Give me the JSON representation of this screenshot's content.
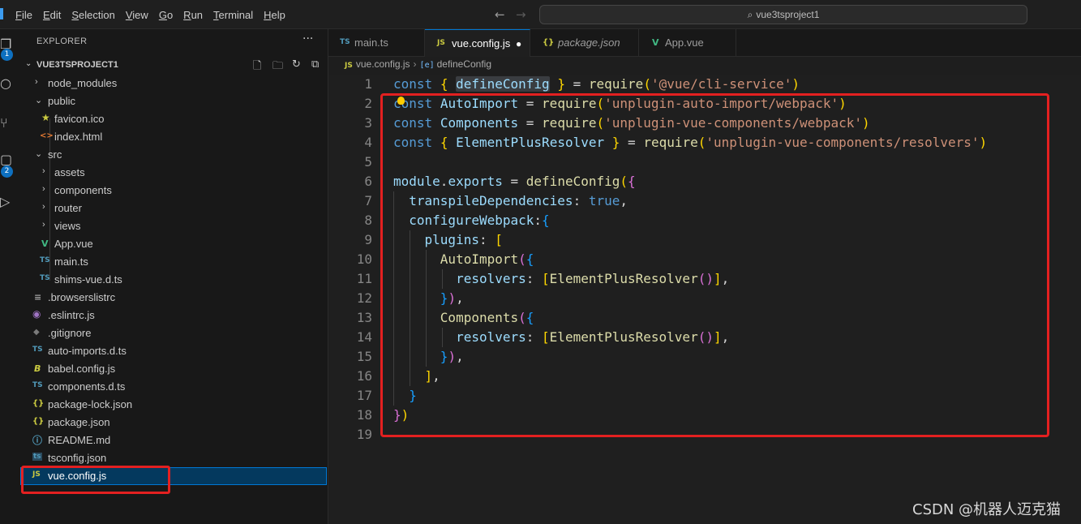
{
  "menubar": [
    "File",
    "Edit",
    "Selection",
    "View",
    "Go",
    "Run",
    "Terminal",
    "Help"
  ],
  "titlebar": {
    "search_text": "vue3tsproject1",
    "back_icon": "arrow-left",
    "forward_icon": "arrow-right"
  },
  "activitybar": {
    "explorer_badge": "1",
    "extensions_badge": "2"
  },
  "sidebar": {
    "title": "EXPLORER",
    "more_label": "···",
    "project_name": "VUE3TSPROJECT1",
    "tree": [
      {
        "label": "node_modules",
        "kind": "folder",
        "expanded": false
      },
      {
        "label": "public",
        "kind": "folder",
        "expanded": true
      },
      {
        "label": "favicon.ico",
        "kind": "file",
        "icon": "★"
      },
      {
        "label": "index.html",
        "kind": "file",
        "icon": "<>"
      },
      {
        "label": "src",
        "kind": "folder",
        "expanded": true
      },
      {
        "label": "assets",
        "kind": "folder",
        "expanded": false
      },
      {
        "label": "components",
        "kind": "folder",
        "expanded": false
      },
      {
        "label": "router",
        "kind": "folder",
        "expanded": false
      },
      {
        "label": "views",
        "kind": "folder",
        "expanded": false
      },
      {
        "label": "App.vue",
        "kind": "file",
        "icon": "V"
      },
      {
        "label": "main.ts",
        "kind": "file",
        "icon": "TS"
      },
      {
        "label": "shims-vue.d.ts",
        "kind": "file",
        "icon": "TS"
      },
      {
        "label": ".browserslistrc",
        "kind": "file",
        "icon": "≡"
      },
      {
        "label": ".eslintrc.js",
        "kind": "file",
        "icon": "◉"
      },
      {
        "label": ".gitignore",
        "kind": "file",
        "icon": "◆"
      },
      {
        "label": "auto-imports.d.ts",
        "kind": "file",
        "icon": "TS"
      },
      {
        "label": "babel.config.js",
        "kind": "file",
        "icon": "B"
      },
      {
        "label": "components.d.ts",
        "kind": "file",
        "icon": "TS"
      },
      {
        "label": "package-lock.json",
        "kind": "file",
        "icon": "{}"
      },
      {
        "label": "package.json",
        "kind": "file",
        "icon": "{}"
      },
      {
        "label": "README.md",
        "kind": "file",
        "icon": "ⓘ"
      },
      {
        "label": "tsconfig.json",
        "kind": "file",
        "icon": "ts"
      },
      {
        "label": "vue.config.js",
        "kind": "file",
        "icon": "JS",
        "selected": true
      }
    ]
  },
  "tabs": [
    {
      "label": "main.ts",
      "icon": "TS",
      "active": false
    },
    {
      "label": "vue.config.js",
      "icon": "JS",
      "active": true,
      "dirty": true
    },
    {
      "label": "package.json",
      "icon": "{}",
      "active": false,
      "italic": true
    },
    {
      "label": "App.vue",
      "icon": "V",
      "active": false
    }
  ],
  "breadcrumb": {
    "file": "vue.config.js",
    "symbol": "defineConfig"
  },
  "editor": {
    "line_numbers": [
      "1",
      "2",
      "3",
      "4",
      "5",
      "6",
      "7",
      "8",
      "9",
      "10",
      "11",
      "12",
      "13",
      "14",
      "15",
      "16",
      "17",
      "18",
      "19"
    ],
    "lines": [
      "const { defineConfig } = require('@vue/cli-service')",
      "const AutoImport = require('unplugin-auto-import/webpack')",
      "const Components = require('unplugin-vue-components/webpack')",
      "const { ElementPlusResolver } = require('unplugin-vue-components/resolvers')",
      "",
      "module.exports = defineConfig({",
      "  transpileDependencies: true,",
      "  configureWebpack:{",
      "    plugins: [",
      "      AutoImport({",
      "        resolvers: [ElementPlusResolver()],",
      "      }),",
      "      Components({",
      "        resolvers: [ElementPlusResolver()],",
      "      }),",
      "    ],",
      "  }",
      "})",
      ""
    ]
  },
  "watermark": "CSDN @机器人迈克猫",
  "colors": {
    "accent": "#0078d4",
    "annotation_red": "#e32020",
    "badge_blue": "#0e70c0"
  }
}
